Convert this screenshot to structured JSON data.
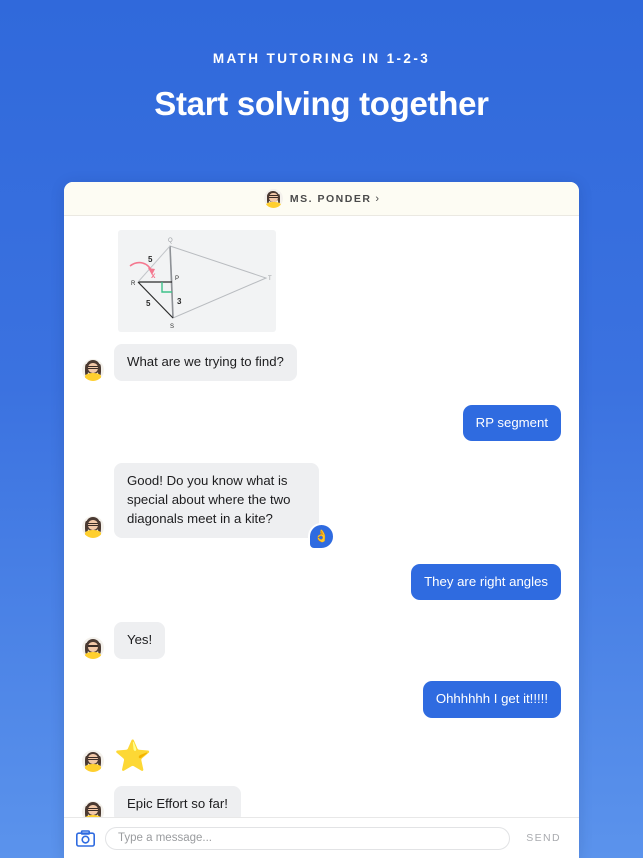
{
  "promo": {
    "eyebrow": "MATH TUTORING IN 1-2-3",
    "title": "Start solving together"
  },
  "chat_header": {
    "tutor_name": "MS. PONDER",
    "chevron": "›",
    "avatar_icon": "tutor-avatar"
  },
  "diagram": {
    "vertices": {
      "Q": "Q",
      "R": "R",
      "P": "P",
      "S": "S",
      "T": "T"
    },
    "labels": {
      "qr_side": "5",
      "unknown": "x",
      "rs_side": "5",
      "ps_side": "3"
    },
    "right_angle_color": "#3ec18a",
    "highlight_color": "#f4788f",
    "stroke_color": "#b9bcc0"
  },
  "messages": [
    {
      "id": "msg-diagram",
      "sender": "tutor",
      "type": "image",
      "text": ""
    },
    {
      "id": "msg-1",
      "sender": "tutor",
      "type": "text",
      "text": "What are we trying to find?"
    },
    {
      "id": "msg-2",
      "sender": "user",
      "type": "text",
      "text": "RP segment"
    },
    {
      "id": "msg-3",
      "sender": "tutor",
      "type": "text",
      "text": "Good! Do you know what is special about where the two diagonals meet in a kite?",
      "reaction": "👌"
    },
    {
      "id": "msg-4",
      "sender": "user",
      "type": "text",
      "text": "They are right angles"
    },
    {
      "id": "msg-5",
      "sender": "tutor",
      "type": "text",
      "text": "Yes!"
    },
    {
      "id": "msg-6",
      "sender": "user",
      "type": "text",
      "text": "Ohhhhhh I get it!!!!!"
    },
    {
      "id": "msg-7",
      "sender": "tutor",
      "type": "emoji",
      "text": "⭐"
    },
    {
      "id": "msg-8",
      "sender": "tutor",
      "type": "text",
      "text": "Epic Effort so far!"
    }
  ],
  "composer": {
    "camera_icon": "camera-icon",
    "input_placeholder": "Type a message...",
    "input_value": "",
    "send_label": "SEND"
  },
  "colors": {
    "background_top": "#3069db",
    "background_bottom": "#5b93ec",
    "user_bubble": "#2f6be0",
    "tutor_bubble": "#eeeff1",
    "header_cream": "#fdfcf3"
  }
}
